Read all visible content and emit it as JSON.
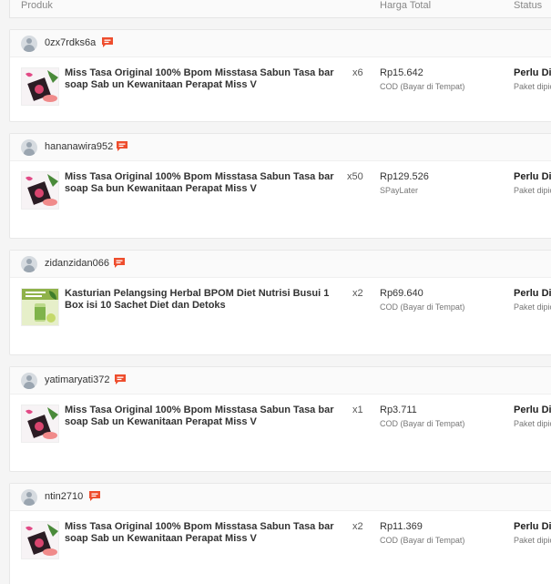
{
  "table_header": {
    "product": "Produk",
    "price": "Harga Total",
    "status": "Status"
  },
  "orders": [
    {
      "username": "0zx7rdks6a",
      "chat_icon": "chat-icon",
      "product_name": "Miss Tasa Original 100% Bpom Misstasa Sabun Tasa bar soap Sab un Kewanitaan Perapat Miss V",
      "product_image": "misstasa-soap-thumbnail",
      "qty": "x6",
      "price": "Rp15.642",
      "payment": "COD (Bayar di Tempat)",
      "status": "Perlu Dik",
      "status_sub": "Paket dipic"
    },
    {
      "username": "hananawira952",
      "chat_icon": "chat-icon",
      "product_name": "Miss Tasa Original 100% Bpom Misstasa Sabun Tasa bar soap Sa bun Kewanitaan Perapat Miss V",
      "product_image": "misstasa-soap-thumbnail",
      "qty": "x50",
      "price": "Rp129.526",
      "payment": "SPayLater",
      "status": "Perlu Dik",
      "status_sub": "Paket dipic"
    },
    {
      "username": "zidanzidan066",
      "chat_icon": "chat-icon",
      "product_name": "Kasturian Pelangsing Herbal BPOM Diet Nutrisi Busui 1 Box isi 10 Sachet Diet dan Detoks",
      "product_image": "kasturian-thumbnail",
      "qty": "x2",
      "price": "Rp69.640",
      "payment": "COD (Bayar di Tempat)",
      "status": "Perlu Dik",
      "status_sub": "Paket dipic"
    },
    {
      "username": "yatimaryati372",
      "chat_icon": "chat-icon",
      "product_name": "Miss Tasa Original 100% Bpom Misstasa Sabun Tasa bar soap Sab un Kewanitaan Perapat Miss V",
      "product_image": "misstasa-soap-thumbnail",
      "qty": "x1",
      "price": "Rp3.711",
      "payment": "COD (Bayar di Tempat)",
      "status": "Perlu Dik",
      "status_sub": "Paket dipic"
    },
    {
      "username": "ntin2710",
      "chat_icon": "chat-icon",
      "product_name": "Miss Tasa Original 100% Bpom Misstasa Sabun Tasa bar soap Sab un Kewanitaan Perapat Miss V",
      "product_image": "misstasa-soap-thumbnail",
      "qty": "x2",
      "price": "Rp11.369",
      "payment": "COD (Bayar di Tempat)",
      "status": "Perlu Dik",
      "status_sub": "Paket dipic"
    }
  ],
  "colors": {
    "chat_accent": "#ee4d2d",
    "page_bg": "#f5f5f5"
  }
}
